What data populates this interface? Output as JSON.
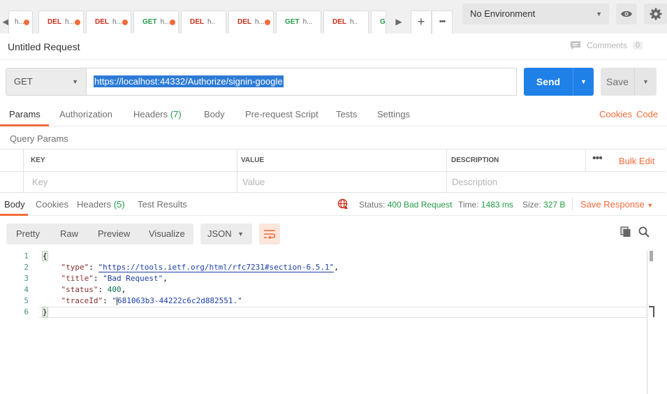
{
  "tabs": [
    {
      "method": "",
      "name": "h...",
      "unsaved": true
    },
    {
      "method": "DEL",
      "name": "h...",
      "unsaved": true
    },
    {
      "method": "DEL",
      "name": "h...",
      "unsaved": true
    },
    {
      "method": "GET",
      "name": "h...",
      "unsaved": true
    },
    {
      "method": "DEL",
      "name": "h..",
      "unsaved": false
    },
    {
      "method": "DEL",
      "name": "h...",
      "unsaved": true
    },
    {
      "method": "GET",
      "name": "h...",
      "unsaved": false
    },
    {
      "method": "DEL",
      "name": "h..",
      "unsaved": false
    },
    {
      "method": "G",
      "name": "",
      "unsaved": false
    }
  ],
  "tab_controls": {
    "prev": "◀",
    "next": "▶",
    "add": "+",
    "more": "•••"
  },
  "environment": {
    "selected": "No Environment"
  },
  "request": {
    "title": "Untitled Request",
    "comments_label": "Comments",
    "comments_count": "0",
    "method": "GET",
    "url": "https://localhost:44332/Authorize/signin-google",
    "send_label": "Send",
    "save_label": "Save"
  },
  "request_tabs": {
    "params": "Params",
    "authorization": "Authorization",
    "headers": "Headers",
    "headers_count": "(7)",
    "body": "Body",
    "prerequest": "Pre-request Script",
    "tests": "Tests",
    "settings": "Settings",
    "cookies": "Cookies",
    "code": "Code"
  },
  "query_params": {
    "title": "Query Params",
    "columns": [
      "KEY",
      "VALUE",
      "DESCRIPTION"
    ],
    "placeholders": [
      "Key",
      "Value",
      "Description"
    ],
    "bulk_edit": "Bulk Edit",
    "more": "•••"
  },
  "response_tabs": {
    "body": "Body",
    "cookies": "Cookies",
    "headers": "Headers",
    "headers_count": "(5)",
    "test_results": "Test Results"
  },
  "response_meta": {
    "status_label": "Status:",
    "status_value": "400 Bad Request",
    "time_label": "Time:",
    "time_value": "1483 ms",
    "size_label": "Size:",
    "size_value": "327 B",
    "save_response": "Save Response"
  },
  "response_toolbar": {
    "formats": [
      "Pretty",
      "Raw",
      "Preview",
      "Visualize"
    ],
    "language": "JSON"
  },
  "response_body": {
    "line_numbers": [
      "1",
      "2",
      "3",
      "4",
      "5",
      "6"
    ],
    "open_brace": "{",
    "close_brace": "}",
    "type_key": "\"type\"",
    "type_value": "\"https://tools.ietf.org/html/rfc7231#section-6.5.1\"",
    "title_key": "\"title\"",
    "title_value": "\"Bad Request\"",
    "status_key": "\"status\"",
    "status_value": "400",
    "trace_key": "\"traceId\"",
    "trace_value_open": "\"",
    "trace_value_rest": "681063b3-44222c6c2d882551.\""
  },
  "colors": {
    "accent": "#f26b3a",
    "send": "#1f80e8",
    "get_method": "#249c47",
    "del_method": "#d02d1a",
    "status_ok": "#249c47"
  }
}
